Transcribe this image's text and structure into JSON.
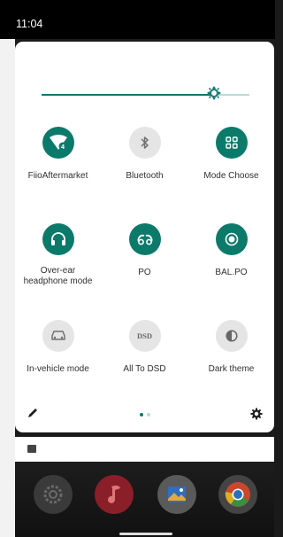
{
  "status": {
    "time": "11:04"
  },
  "brightness": {
    "level": 0.83,
    "fill_color": "#0c7a6b",
    "track_color": "#b7d9d6"
  },
  "tiles": [
    {
      "label": "FiioAftermarket",
      "state": "on",
      "icon": "wifi-icon"
    },
    {
      "label": "Bluetooth",
      "state": "off",
      "icon": "bluetooth-icon"
    },
    {
      "label": "Mode Choose",
      "state": "on",
      "icon": "grid-icon"
    },
    {
      "label": "Over-ear\nheadphone mode",
      "state": "on",
      "icon": "headphones-icon"
    },
    {
      "label": "PO",
      "state": "on",
      "icon": "earbuds-icon"
    },
    {
      "label": "BAL.PO",
      "state": "on",
      "icon": "record-icon"
    },
    {
      "label": "In-vehicle mode",
      "state": "off",
      "icon": "car-icon"
    },
    {
      "label": "All To DSD",
      "state": "off",
      "icon": "dsd-icon"
    },
    {
      "label": "Dark theme",
      "state": "off",
      "icon": "contrast-icon"
    }
  ],
  "wifi_badge": "4",
  "dsd_icon_text": "DSD",
  "pager": {
    "pages": 2,
    "current": 0,
    "active_color": "#0c7a6b",
    "inactive_color": "#b7d9d6"
  },
  "colors": {
    "accent": "#0c7a6b"
  }
}
